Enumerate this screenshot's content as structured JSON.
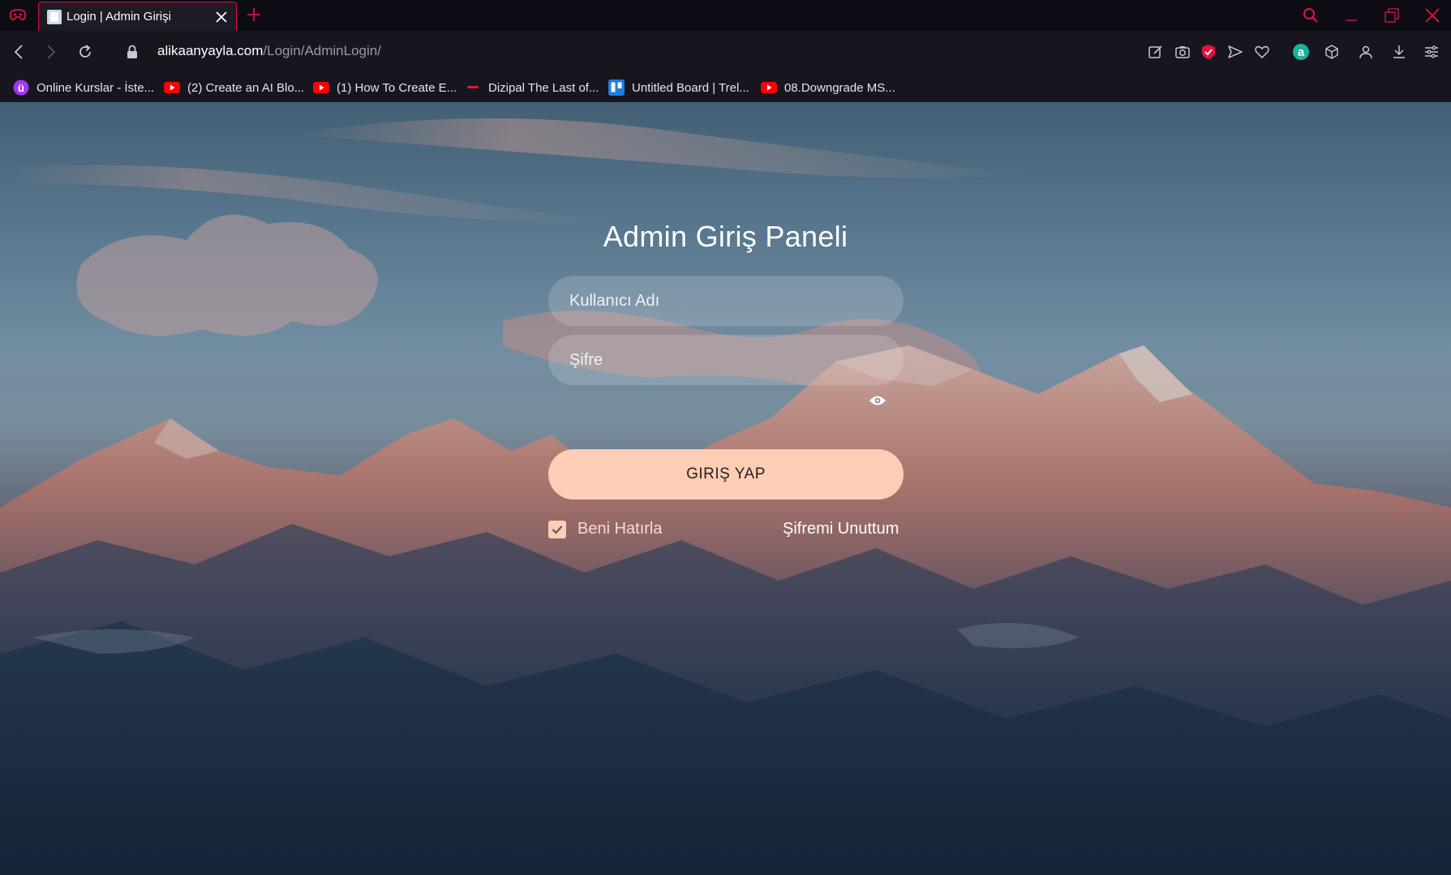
{
  "browser": {
    "tab": {
      "title": "Login | Admin Girişi"
    },
    "address": {
      "host": "alikaanyayla.com",
      "path": "/Login/AdminLogin/"
    },
    "bookmarks": [
      {
        "label": "Online Kurslar - İste...",
        "icon": "udemy-icon"
      },
      {
        "label": "(2) Create an AI Blo...",
        "icon": "youtube-icon"
      },
      {
        "label": "(1) How To Create E...",
        "icon": "youtube-icon"
      },
      {
        "label": "Dizipal The Last of...",
        "icon": "dizipal-icon"
      },
      {
        "label": "Untitled Board | Trel...",
        "icon": "trello-icon"
      },
      {
        "label": "08.Downgrade MS...",
        "icon": "youtube-icon"
      }
    ],
    "colors": {
      "accent": "#d8103f",
      "chrome_bg": "#17161f",
      "tabbar_bg": "#0d0c14"
    }
  },
  "login": {
    "title": "Admin Giriş Paneli",
    "username": {
      "placeholder": "Kullanıcı Adı",
      "value": ""
    },
    "password": {
      "placeholder": "Şifre",
      "value": ""
    },
    "submit_label": "GIRIŞ YAP",
    "remember": {
      "label": "Beni Hatırla",
      "checked": true
    },
    "forgot_label": "Şifremi Unuttum",
    "colors": {
      "button": "#fdcdb6",
      "input_bg": "rgba(255,255,255,0.16)"
    }
  }
}
